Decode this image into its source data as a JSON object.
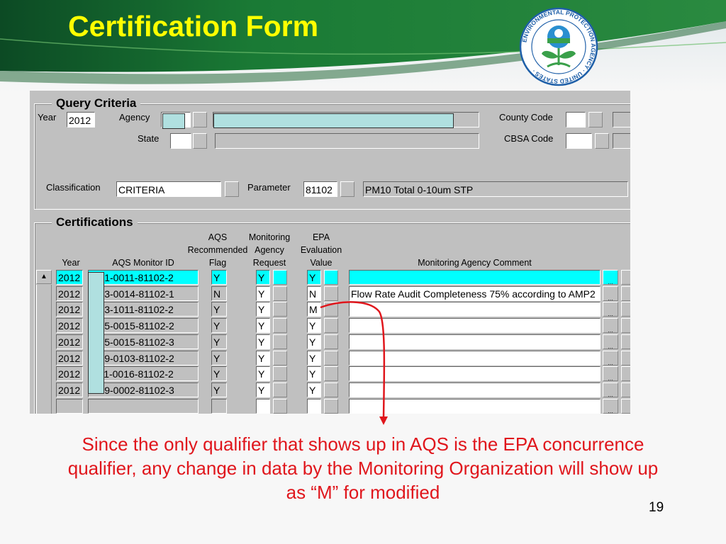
{
  "slide": {
    "title": "Certification Form",
    "caption_lines": [
      "Since the only qualifier that shows up in AQS is the EPA concurrence",
      "qualifier, any change in data by the Monitoring Organization will show up",
      "as “M” for modified"
    ],
    "page_number": "19",
    "logo": {
      "top_text": "UNITED STATES",
      "ring_text": "ENVIRONMENTAL PROTECTION AGENCY"
    },
    "colors": {
      "title": "#ffff00",
      "banner": "#1a7a35",
      "caption": "#e0161c",
      "highlight_row": "#00ffff",
      "annotation_arrow": "#e0161c"
    }
  },
  "query_criteria": {
    "title": "Query Criteria",
    "year_label": "Year",
    "year_value": "2012",
    "agency_label": "Agency",
    "agency_value": "",
    "state_label": "State",
    "state_value": "",
    "county_label": "County Code",
    "county_value": "",
    "cbsa_label": "CBSA Code",
    "cbsa_value": "",
    "classification_label": "Classification",
    "classification_value": "CRITERIA",
    "parameter_label": "Parameter",
    "parameter_code": "81102",
    "parameter_desc": "PM10 Total 0-10um STP",
    "lov_button": ""
  },
  "certifications": {
    "title": "Certifications",
    "headers": {
      "year": "Year",
      "monitor_id": "AQS Monitor ID",
      "aqs_flag": [
        "AQS",
        "Recommended",
        "Flag"
      ],
      "agency_request": [
        "Monitoring",
        "Agency",
        "Request"
      ],
      "epa_value": [
        "EPA",
        "Evaluation",
        "Value"
      ],
      "comment": "Monitoring Agency Comment"
    },
    "more_button": "...",
    "scroll_up": "▲",
    "rows": [
      {
        "year": "2012",
        "monitor_id": "-001-0011-81102-2",
        "aqs_flag": "Y",
        "agency_request": "Y",
        "epa_value": "Y",
        "comment": "",
        "selected": true
      },
      {
        "year": "2012",
        "monitor_id": "-003-0014-81102-1",
        "aqs_flag": "N",
        "agency_request": "Y",
        "epa_value": "N",
        "comment": "Flow Rate Audit Completeness 75% according to AMP2",
        "selected": false
      },
      {
        "year": "2012",
        "monitor_id": "-003-1011-81102-2",
        "aqs_flag": "Y",
        "agency_request": "Y",
        "epa_value": "M",
        "comment": "",
        "selected": false
      },
      {
        "year": "2012",
        "monitor_id": "-005-0015-81102-2",
        "aqs_flag": "Y",
        "agency_request": "Y",
        "epa_value": "Y",
        "comment": "",
        "selected": false
      },
      {
        "year": "2012",
        "monitor_id": "-005-0015-81102-3",
        "aqs_flag": "Y",
        "agency_request": "Y",
        "epa_value": "Y",
        "comment": "",
        "selected": false
      },
      {
        "year": "2012",
        "monitor_id": "-009-0103-81102-2",
        "aqs_flag": "Y",
        "agency_request": "Y",
        "epa_value": "Y",
        "comment": "",
        "selected": false
      },
      {
        "year": "2012",
        "monitor_id": "-011-0016-81102-2",
        "aqs_flag": "Y",
        "agency_request": "Y",
        "epa_value": "Y",
        "comment": "",
        "selected": false
      },
      {
        "year": "2012",
        "monitor_id": "-019-0002-81102-3",
        "aqs_flag": "Y",
        "agency_request": "Y",
        "epa_value": "Y",
        "comment": "",
        "selected": false
      },
      {
        "year": "",
        "monitor_id": "",
        "aqs_flag": "",
        "agency_request": "",
        "epa_value": "",
        "comment": "",
        "selected": false
      }
    ]
  }
}
